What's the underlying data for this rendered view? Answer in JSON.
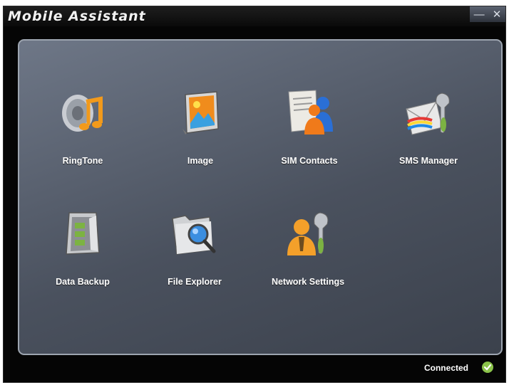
{
  "window": {
    "title": "Mobile Assistant",
    "controls": {
      "minimize": "—",
      "close": "✕"
    }
  },
  "tiles": [
    {
      "label": "RingTone",
      "icon": "ringtone-speaker-icon"
    },
    {
      "label": "Image",
      "icon": "image-picture-icon"
    },
    {
      "label": "SIM Contacts",
      "icon": "sim-contacts-icon"
    },
    {
      "label": "SMS Manager",
      "icon": "sms-envelope-wrench-icon"
    },
    {
      "label": "Data Backup",
      "icon": "data-backup-cabinet-icon"
    },
    {
      "label": "File Explorer",
      "icon": "file-explorer-folder-magnifier-icon"
    },
    {
      "label": "Network Settings",
      "icon": "network-settings-person-wrench-icon"
    }
  ],
  "status": {
    "text": "Connected",
    "icon": "connected-check-icon",
    "color": "#8bc34a"
  }
}
